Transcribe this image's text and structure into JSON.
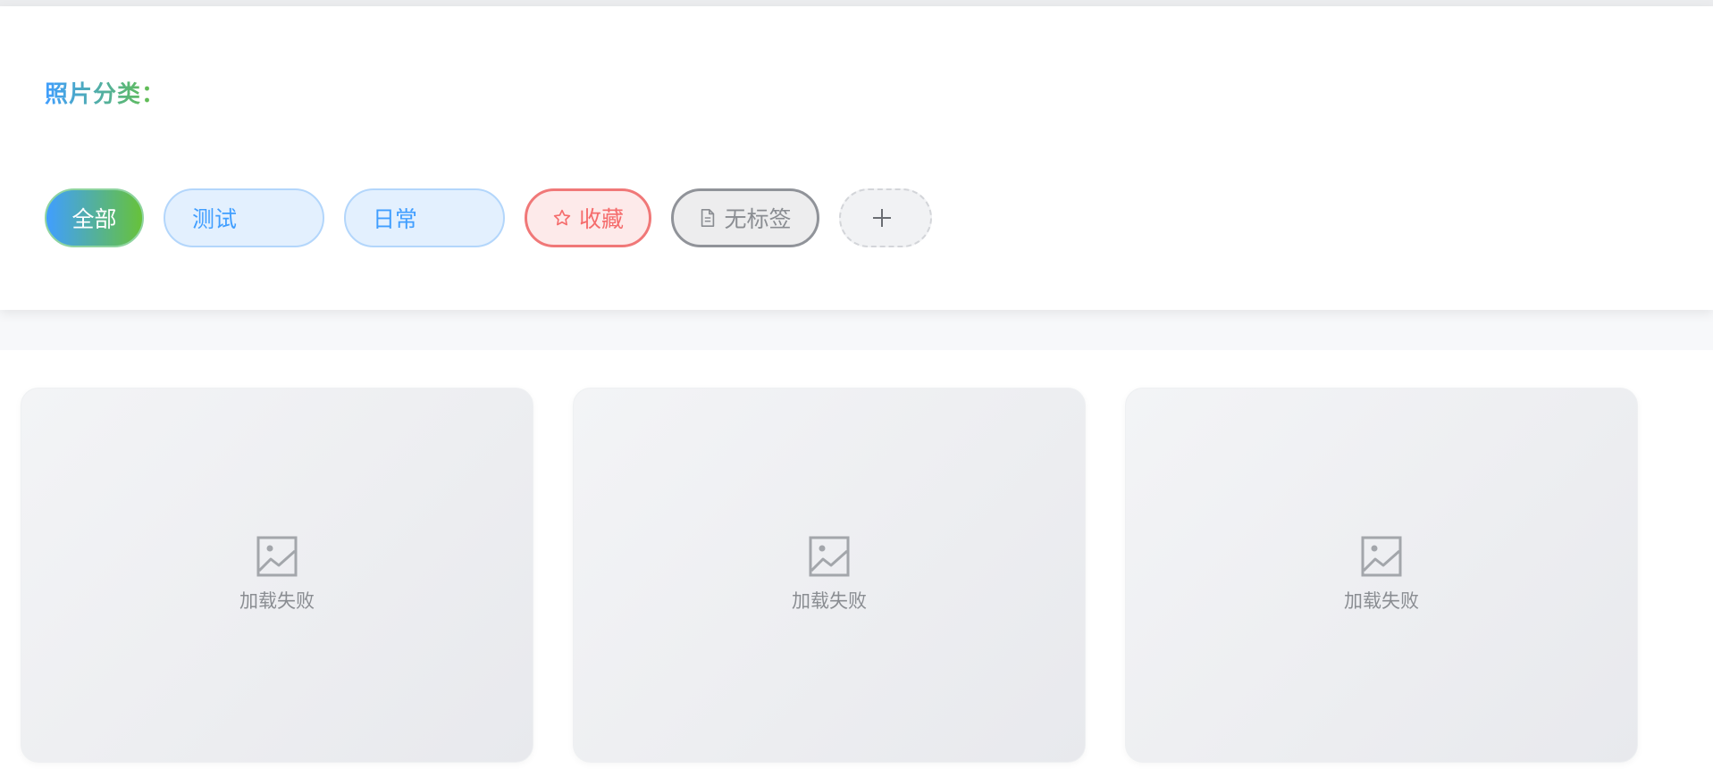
{
  "header": {
    "title": "照片分类："
  },
  "tags": {
    "all": "全部",
    "test": "测试",
    "daily": "日常",
    "favorite": "收藏",
    "untagged": "无标签",
    "add": "+",
    "favorite_icon": "star-icon",
    "untagged_icon": "document-icon"
  },
  "gallery": {
    "cards": [
      {
        "status": "加载失败",
        "icon": "image-icon"
      },
      {
        "status": "加载失败",
        "icon": "image-icon"
      },
      {
        "status": "加载失败",
        "icon": "image-icon"
      }
    ]
  },
  "colors": {
    "accent_blue": "#409eff",
    "accent_green": "#67c23a",
    "favorite_red": "#f56c6c",
    "neutral_gray": "#909399"
  }
}
